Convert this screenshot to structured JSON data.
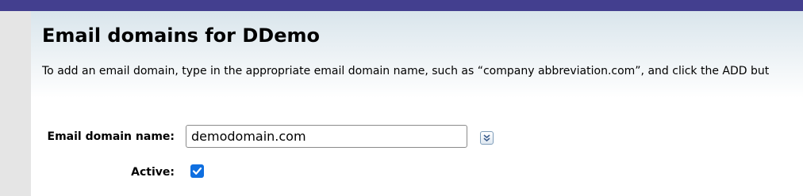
{
  "page": {
    "title": "Email domains for DDemo",
    "instructions": "To add an email domain, type in the appropriate email domain name, such as “company abbreviation.com”, and click the ADD but"
  },
  "form": {
    "domain_label": "Email domain name:",
    "domain_value": "demodomain.com",
    "expand_icon": "double-chevron-down-icon",
    "active_label": "Active:",
    "active_checked": true
  },
  "colors": {
    "topbar": "#433f8f",
    "checkbox": "#0f6fe0",
    "left_rail": "#e5e5e5"
  }
}
